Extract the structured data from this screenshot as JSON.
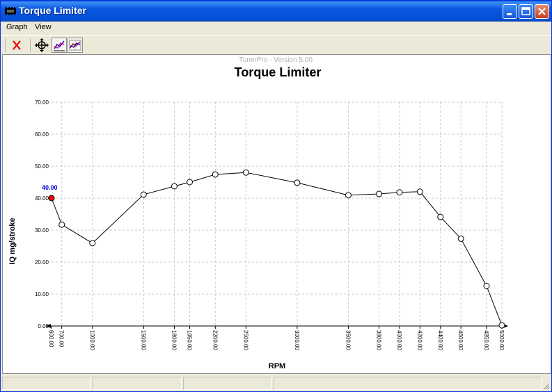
{
  "window": {
    "title": "Torque Limiter"
  },
  "menu": {
    "graph": "Graph",
    "view": "View"
  },
  "chart_data": {
    "type": "line",
    "version_text": "TunerPro - Version 5.00",
    "title": "Torque Limiter",
    "xlabel": "RPM",
    "ylabel": "IQ mg/stroke",
    "ylim": [
      0,
      70
    ],
    "y_ticks": [
      "0.00",
      "10.00",
      "20.00",
      "30.00",
      "40.00",
      "50.00",
      "60.00",
      "70.00"
    ],
    "grid": true,
    "x": [
      600,
      700,
      1000,
      1500,
      1800,
      1950,
      2200,
      2500,
      3000,
      3500,
      3800,
      4000,
      4200,
      4400,
      4600,
      4850,
      5000
    ],
    "x_tick_labels": [
      "600.00",
      "700.00",
      "1000.00",
      "1500.00",
      "1800.00",
      "1950.00",
      "2200.00",
      "2500.00",
      "3000.00",
      "3500.00",
      "3800.00",
      "4000.00",
      "4200.00",
      "4400.00",
      "4600.00",
      "4850.00",
      "5000.00"
    ],
    "values": [
      40.0,
      31.7,
      25.9,
      41.1,
      43.7,
      45.0,
      47.4,
      48.0,
      44.8,
      40.9,
      41.3,
      41.8,
      42.0,
      34.1,
      27.3,
      12.5,
      0.2
    ],
    "selected_index": 0,
    "selected_label": "40.00",
    "colors": {
      "line": "#000000",
      "selected": "#ff0000",
      "selected_label": "#0000cc",
      "grid": "#c8c8c8"
    }
  }
}
